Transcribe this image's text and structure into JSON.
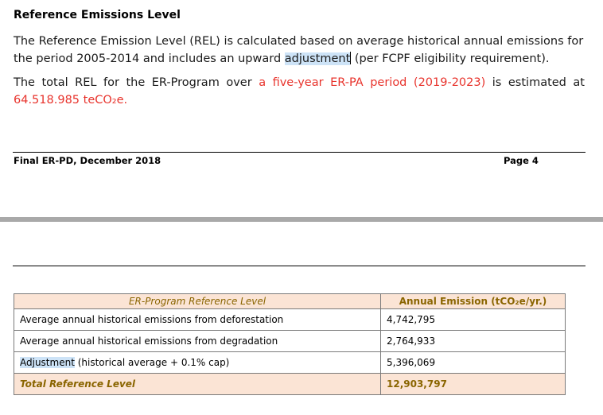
{
  "document": {
    "heading": "Reference Emissions Level",
    "para1": {
      "before": "The Reference Emission Level (REL) is calculated based on average historical annual emissions for the period 2005-2014 and includes an upward ",
      "highlight": "adjustment",
      "after": " (per FCPF eligibility requirement)."
    },
    "para2": {
      "before": "The total REL for the ER-Program over ",
      "red_period": "a five-year ER-PA period (2019-2023)",
      "middle": " is estimated at ",
      "red_value": "64.518.985 teCO₂e."
    },
    "footer": {
      "left": "Final ER-PD, December 2018",
      "right": "Page 4"
    }
  },
  "table": {
    "header": {
      "col1": "ER-Program Reference Level",
      "col2": "Annual Emission (tCO₂e/yr.)"
    },
    "rows": [
      {
        "label": "Average annual historical emissions from deforestation",
        "value": "4,742,795"
      },
      {
        "label": "Average annual historical emissions from degradation",
        "value": "2,764,933"
      },
      {
        "label_highlight": "Adjustment",
        "label_rest": " (historical average + 0.1% cap)",
        "value": "5,396,069"
      }
    ],
    "total": {
      "label": "Total Reference Level",
      "value": "12,903,797"
    }
  },
  "colors": {
    "red_text": "#e8332c",
    "highlight": "#cde3f7",
    "table_header_bg": "#fbe4d5",
    "table_header_text": "#8a6500",
    "page_gap": "#a9a9a9"
  }
}
